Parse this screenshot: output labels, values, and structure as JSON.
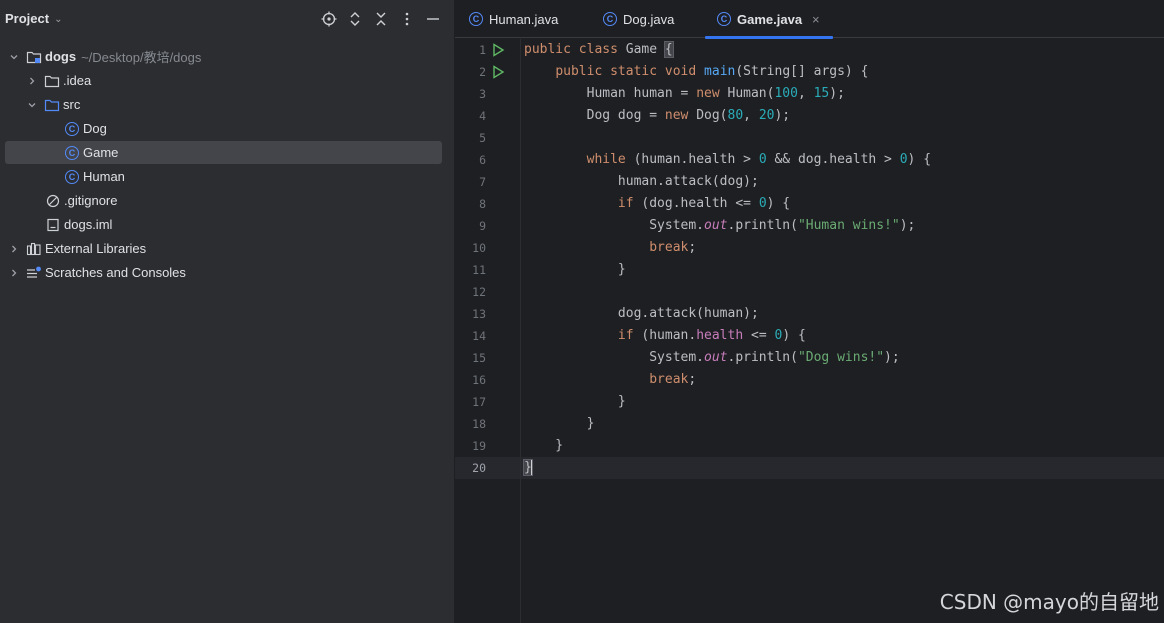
{
  "project_panel": {
    "title": "Project",
    "toolbar_icons": [
      "locate-icon",
      "expand-all-icon",
      "collapse-all-icon",
      "more-options-icon",
      "minimize-icon"
    ],
    "tree": [
      {
        "label": "dogs",
        "path": "~/Desktop/教培/dogs",
        "icon": "module-folder-icon",
        "expanded": true
      },
      {
        "label": ".idea",
        "icon": "folder-icon",
        "expanded": false
      },
      {
        "label": "src",
        "icon": "source-folder-icon",
        "expanded": true
      },
      {
        "label": "Dog",
        "icon": "class-icon"
      },
      {
        "label": "Game",
        "icon": "class-icon",
        "selected": true
      },
      {
        "label": "Human",
        "icon": "class-icon"
      },
      {
        "label": ".gitignore",
        "icon": "ignore-file-icon"
      },
      {
        "label": "dogs.iml",
        "icon": "iml-file-icon"
      },
      {
        "label": "External Libraries",
        "icon": "libraries-icon",
        "expanded": false
      },
      {
        "label": "Scratches and Consoles",
        "icon": "scratches-icon",
        "expanded": false
      }
    ]
  },
  "editor": {
    "tabs": [
      {
        "label": "Human.java",
        "active": false
      },
      {
        "label": "Dog.java",
        "active": false
      },
      {
        "label": "Game.java",
        "active": true,
        "close": "×"
      }
    ],
    "line_numbers": [
      "1",
      "2",
      "3",
      "4",
      "5",
      "6",
      "7",
      "8",
      "9",
      "10",
      "11",
      "12",
      "13",
      "14",
      "15",
      "16",
      "17",
      "18",
      "19",
      "20"
    ],
    "current_line": 20,
    "code": [
      "public class Game {",
      "    public static void main(String[] args) {",
      "        Human human = new Human(100, 15);",
      "        Dog dog = new Dog(80, 20);",
      "",
      "        while (human.health > 0 && dog.health > 0) {",
      "            human.attack(dog);",
      "            if (dog.health <= 0) {",
      "                System.out.println(\"Human wins!\");",
      "                break;",
      "            }",
      "",
      "            dog.attack(human);",
      "            if (human.health <= 0) {",
      "                System.out.println(\"Dog wins!\");",
      "                break;",
      "            }",
      "        }",
      "    }",
      "}"
    ]
  },
  "watermark": "CSDN @mayo的自留地",
  "colors": {
    "keyword": "#cf8e6d",
    "method": "#56a8f5",
    "number": "#2aacb8",
    "string": "#6aab73",
    "static_field": "#c77dbb",
    "accent": "#3574f0"
  }
}
